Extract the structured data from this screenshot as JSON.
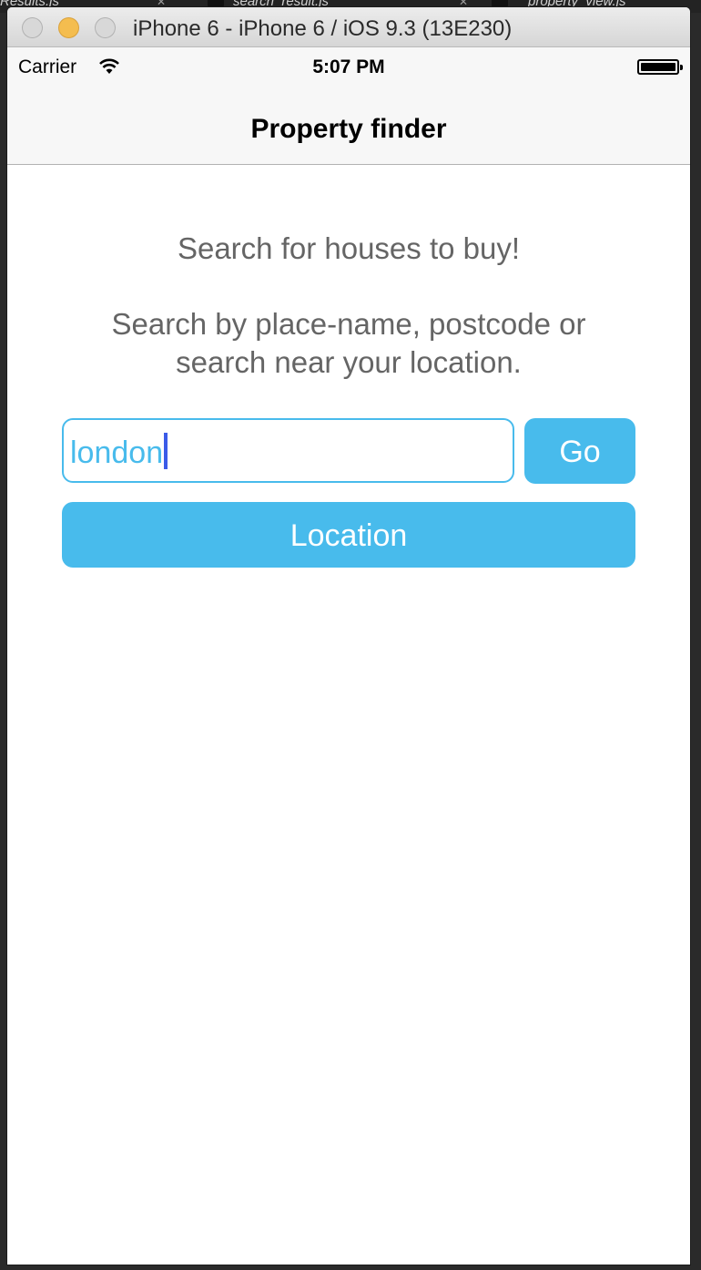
{
  "editor_tabs": [
    {
      "label": "Results.js"
    },
    {
      "label": "search_result.js"
    },
    {
      "label": "property_view.js"
    }
  ],
  "window": {
    "title": "iPhone 6 - iPhone 6 / iOS 9.3 (13E230)"
  },
  "status_bar": {
    "carrier": "Carrier",
    "time": "5:07 PM"
  },
  "nav": {
    "title": "Property finder"
  },
  "main": {
    "description_1": "Search for houses to buy!",
    "description_2_line1": "Search by place-name, postcode or",
    "description_2_line2": "search near your location.",
    "search_value": "london",
    "go_label": "Go",
    "location_label": "Location"
  },
  "colors": {
    "accent": "#48bbec",
    "text_muted": "#656565"
  }
}
